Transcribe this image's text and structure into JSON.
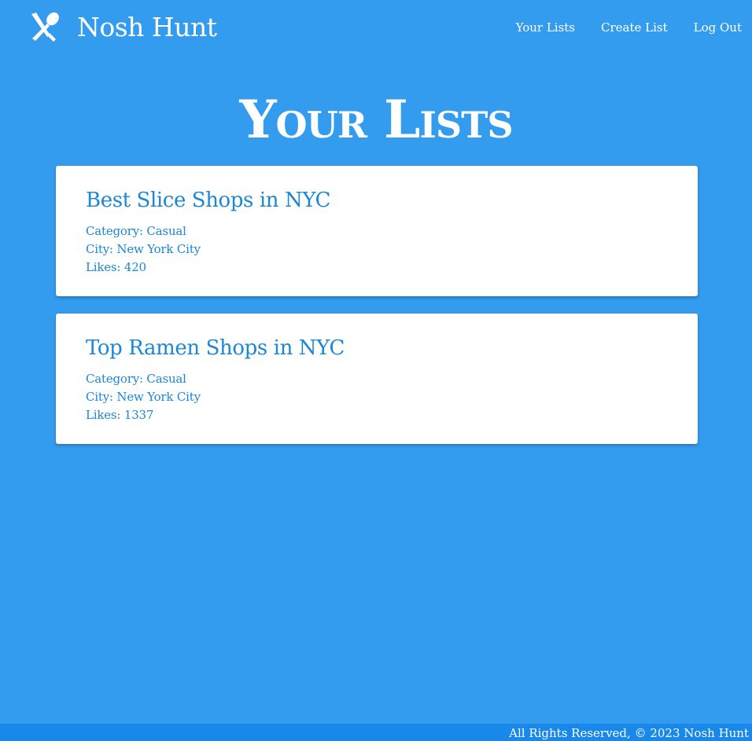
{
  "header": {
    "brand_name": "Nosh Hunt",
    "brand_icon": "utensils-icon",
    "nav": [
      {
        "label": "Your Lists"
      },
      {
        "label": "Create List"
      },
      {
        "label": "Log Out"
      }
    ]
  },
  "page": {
    "title": "Your Lists"
  },
  "lists": [
    {
      "title": "Best Slice Shops in NYC",
      "category": "Category: Casual",
      "city": "City: New York City",
      "likes": "Likes: 420"
    },
    {
      "title": "Top Ramen Shops in NYC",
      "category": "Category: Casual",
      "city": "City: New York City",
      "likes": "Likes: 1337"
    }
  ],
  "footer": {
    "text": "All Rights Reserved, © 2023 Nosh Hunt"
  },
  "colors": {
    "background": "#349cef",
    "footer": "#1888ea",
    "card_text": "#1b87d6",
    "card_bg": "#ffffff"
  }
}
